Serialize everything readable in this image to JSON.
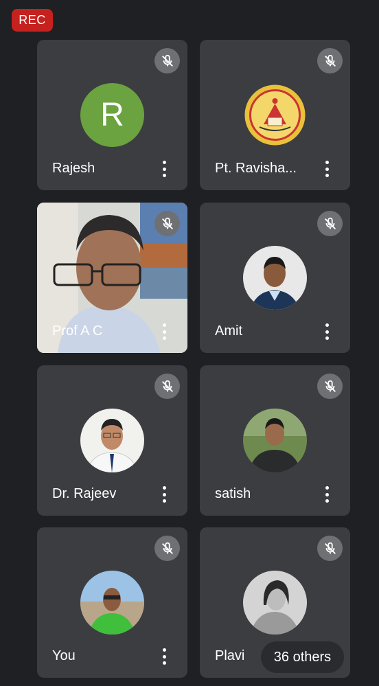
{
  "recording_label": "REC",
  "participants": [
    {
      "name": "Rajesh",
      "avatar_letter": "R",
      "avatar_color": "#6aa33f"
    },
    {
      "name": "Pt. Ravisha..."
    },
    {
      "name": "Prof A C"
    },
    {
      "name": "Amit"
    },
    {
      "name": "Dr. Rajeev"
    },
    {
      "name": "satish"
    },
    {
      "name": "You"
    },
    {
      "name": "Plavi"
    }
  ],
  "others_label": "36 others",
  "colors": {
    "rec": "#c5221f",
    "tile": "#3c3d41",
    "background": "#1f2023"
  }
}
